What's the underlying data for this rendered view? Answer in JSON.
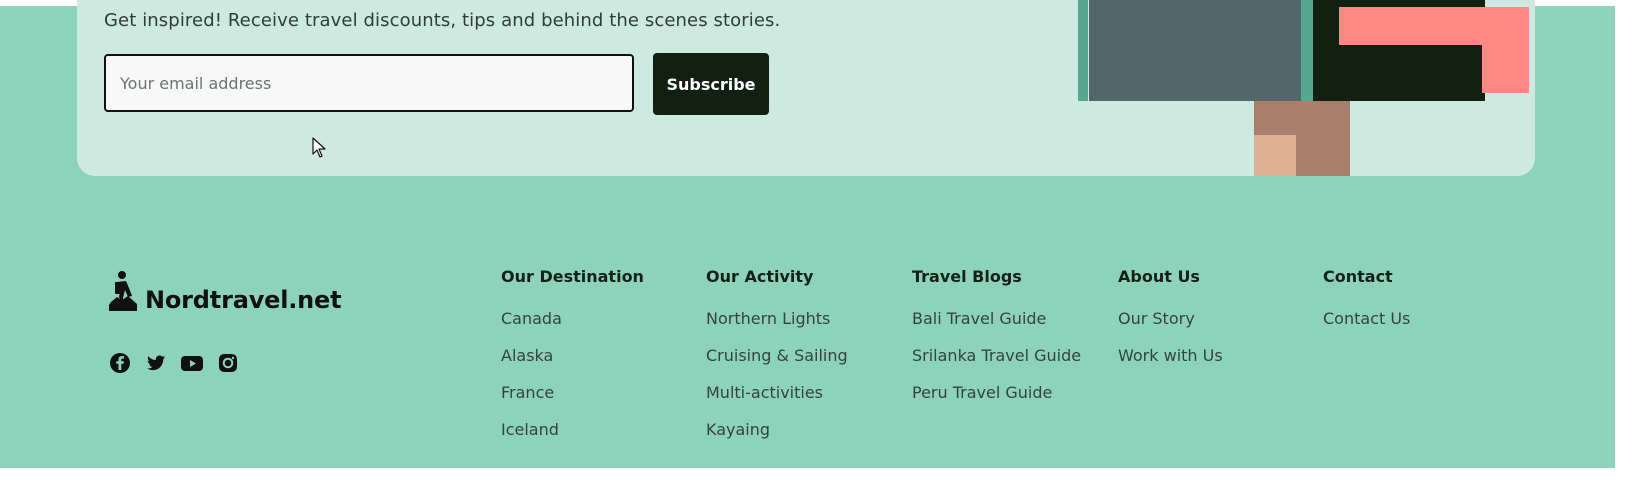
{
  "newsletter": {
    "message": "Get inspired! Receive travel discounts, tips and behind the scenes stories.",
    "email_placeholder": "Your email address",
    "subscribe_label": "Subscribe"
  },
  "brand": {
    "name": "Nordtravel.net"
  },
  "social": [
    {
      "icon": "facebook-icon"
    },
    {
      "icon": "twitter-icon"
    },
    {
      "icon": "youtube-icon"
    },
    {
      "icon": "instagram-icon"
    }
  ],
  "columns": [
    {
      "heading": "Our Destination",
      "links": [
        "Canada",
        "Alaska",
        "France",
        "Iceland"
      ]
    },
    {
      "heading": "Our Activity",
      "links": [
        "Northern Lights",
        "Cruising & Sailing",
        "Multi-activities",
        "Kayaing"
      ]
    },
    {
      "heading": "Travel Blogs",
      "links": [
        "Bali Travel Guide",
        "Srilanka Travel Guide",
        "Peru Travel Guide"
      ]
    },
    {
      "heading": "About Us",
      "links": [
        "Our Story",
        "Work with Us"
      ]
    },
    {
      "heading": "Contact",
      "links": [
        "Contact Us"
      ]
    }
  ],
  "colors": {
    "footer_background": "#8dd3bb",
    "newsletter_panel": "#cde9e0",
    "button_background": "#122012",
    "accent_pink": "#ff8884",
    "slate_block": "#526769",
    "brown_block": "#a87f6d",
    "tan_block": "#e0ae91"
  }
}
